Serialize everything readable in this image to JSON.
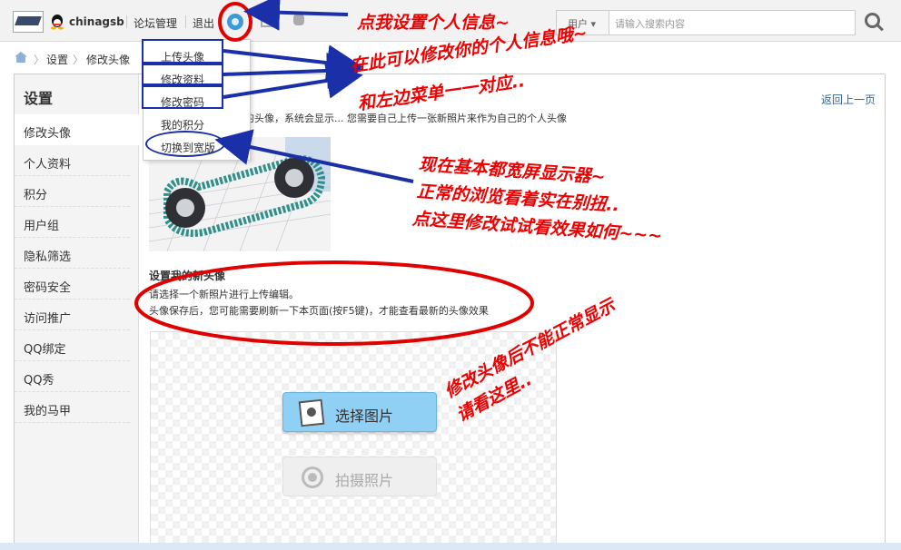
{
  "topbar": {
    "username": "chinagsb",
    "links": [
      "论坛管理",
      "退出"
    ],
    "search_type": "用户 ▾",
    "search_placeholder": "请输入搜索内容"
  },
  "dropdown": {
    "items": [
      "上传头像",
      "修改资料",
      "修改密码",
      "我的积分",
      "切换到宽版"
    ]
  },
  "breadcrumb": [
    "设置",
    "修改头像"
  ],
  "sidebar": {
    "title": "设置",
    "items": [
      "修改头像",
      "个人资料",
      "积分",
      "用户组",
      "隐私筛选",
      "密码安全",
      "访问推广",
      "QQ绑定",
      "QQ秀",
      "我的马甲"
    ]
  },
  "main": {
    "desc": "己的头像，系统会显示... 您需要自己上传一张新照片来作为自己的个人头像",
    "back_link": "返回上一页",
    "section_title": "设置我的新头像",
    "line1": "请选择一个新照片进行上传编辑。",
    "line2": "头像保存后，您可能需要刷新一下本页面(按F5键)，才能查看最新的头像效果",
    "choose_btn": "选择图片",
    "shoot_btn": "拍摄照片"
  },
  "annotations": {
    "gear_note": "点我设置个人信息~",
    "menu_note_1": "在此可以修改你的个人信息哦~",
    "menu_note_2": "和左边菜单一一对应..",
    "wide_note_1": "现在基本都宽屏显示器~",
    "wide_note_2": "正常的浏览看着实在别扭..",
    "wide_note_3": "点这里修改试试看效果如何~~~",
    "avatar_note_1": "修改头像后不能正常显示",
    "avatar_note_2": "请看这里.."
  },
  "colors": {
    "annotation_red": "#ee0000",
    "annotation_blue": "#1a2fa8",
    "link_blue": "#336699",
    "button_blue": "#8fd0f4"
  }
}
